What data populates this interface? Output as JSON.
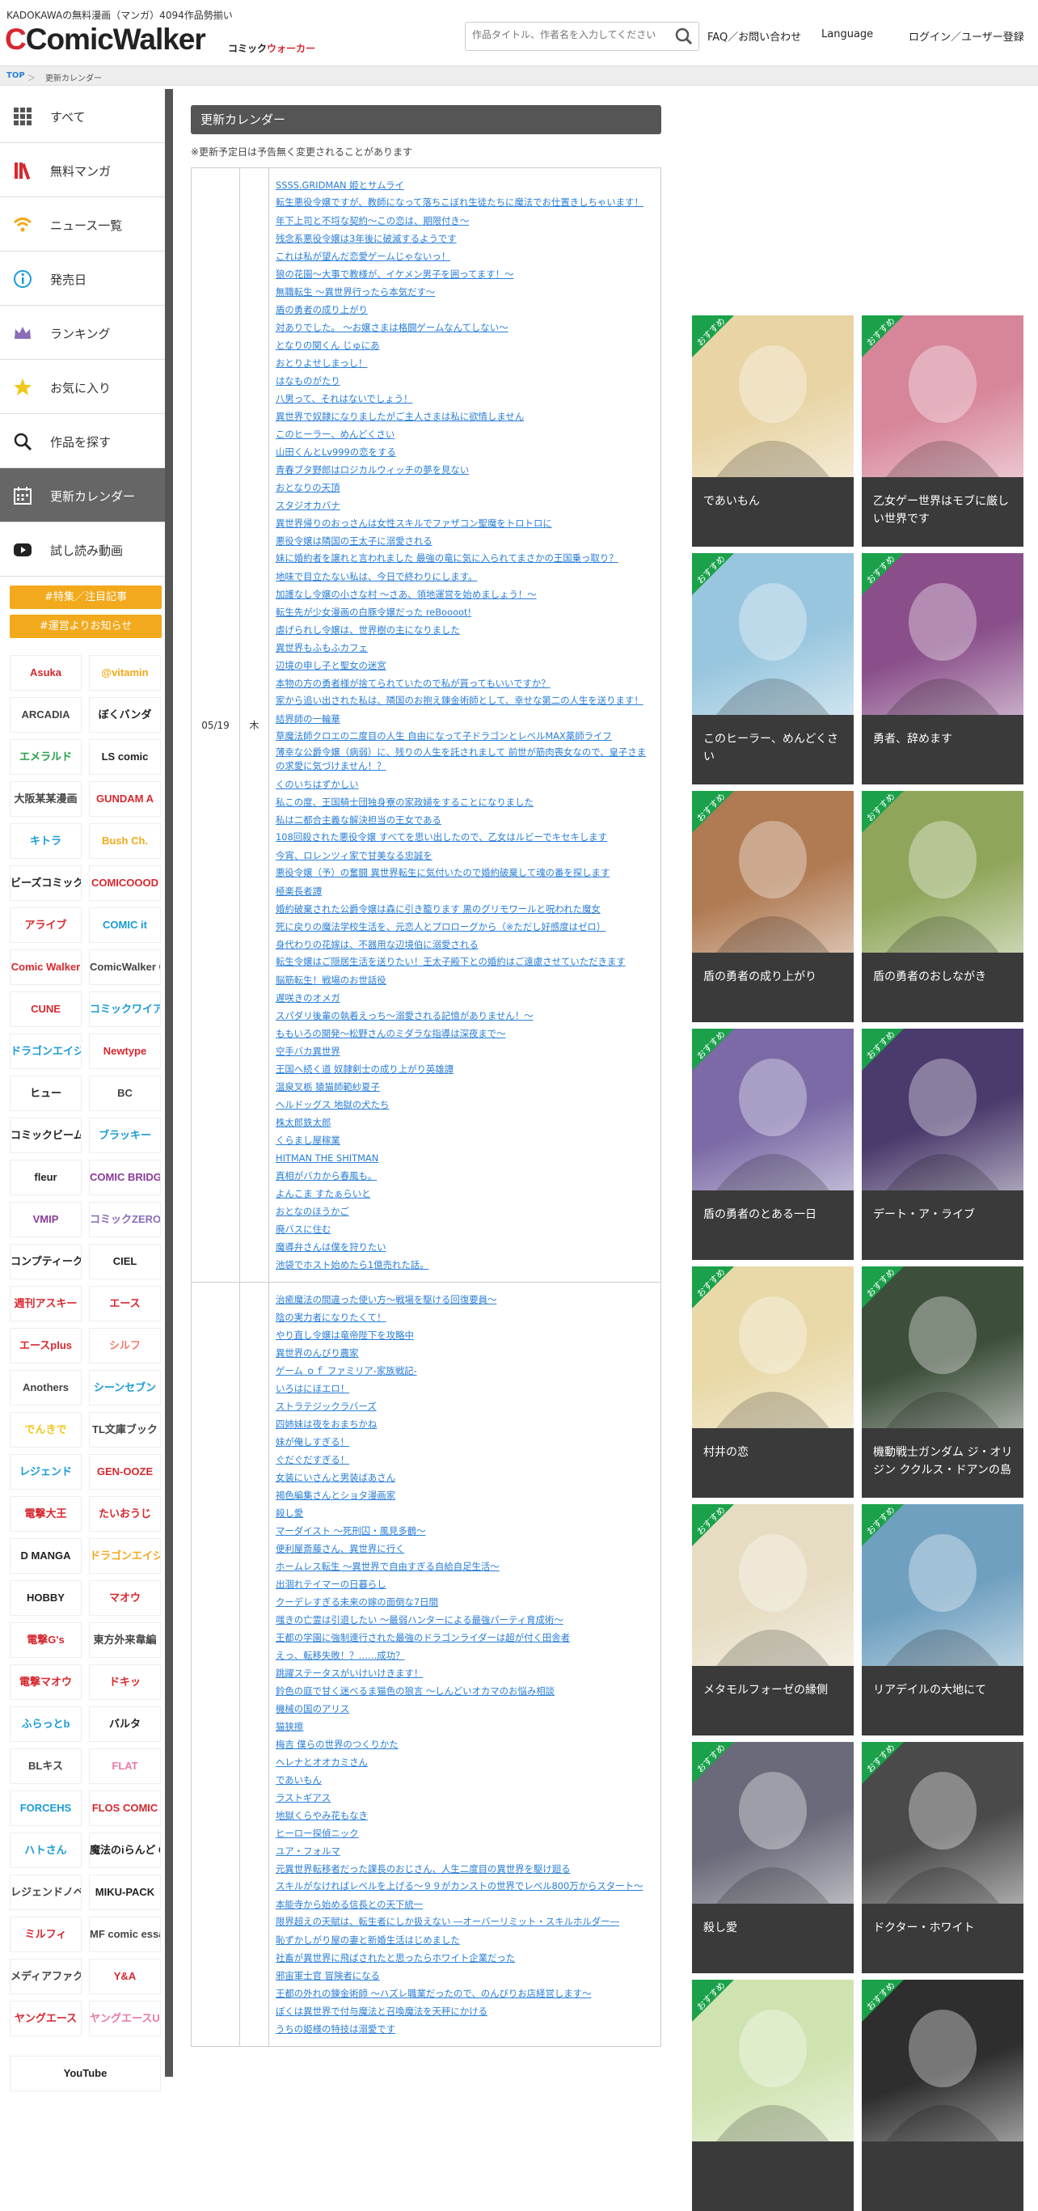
{
  "header": {
    "tagline": "KADOKAWAの無料漫画（マンガ）4094作品勢揃い",
    "logo_main": "ComicWalker",
    "logo_sub_1": "コミック",
    "logo_sub_2": "ウォーカー",
    "search_placeholder": "作品タイトル、作者名を入力してください",
    "nav": {
      "faq": "FAQ／お問い合わせ",
      "language": "Language",
      "login": "ログイン／ユーザー登録"
    }
  },
  "breadcrumb": {
    "top": "TOP",
    "sep": "＞",
    "current": "更新カレンダー"
  },
  "sidebar": {
    "items": [
      {
        "label": "すべて",
        "icon": "grid-icon"
      },
      {
        "label": "無料マンガ",
        "icon": "books-icon"
      },
      {
        "label": "ニュース一覧",
        "icon": "wifi-icon"
      },
      {
        "label": "発売日",
        "icon": "info-icon"
      },
      {
        "label": "ランキング",
        "icon": "crown-icon"
      },
      {
        "label": "お気に入り",
        "icon": "star-icon"
      },
      {
        "label": "作品を探す",
        "icon": "search-icon"
      },
      {
        "label": "更新カレンダー",
        "icon": "calendar-icon"
      },
      {
        "label": "試し読み動画",
        "icon": "youtube-icon"
      }
    ],
    "special_btn": "#特集／注目記事",
    "notice_btn": "#運営よりお知らせ",
    "labels": [
      "Asuka",
      "@vitamin",
      "ARCADIA",
      "ぼくバンダ",
      "エメラルド",
      "LS comic",
      "大阪某某漫画",
      "GUNDAM A",
      "キトラ",
      "Bush Ch.",
      "ビーズコミック",
      "COMICOOOD",
      "アライブ",
      "COMIC it",
      "Comic Walker",
      "ComicWalker GLOBAL",
      "CUNE",
      "コミックワイア",
      "ドラゴンエイジ",
      "Newtype",
      "ヒュー",
      "BC",
      "コミックビーム",
      "ブラッキー",
      "fleur",
      "COMIC BRIDGE",
      "VMIP",
      "コミックZERO",
      "コンプティーク",
      "CIEL",
      "週刊アスキー",
      "エース",
      "エースplus",
      "シルフ",
      "Anothers",
      "シーンセブン",
      "でんきで",
      "TL文庫ブック",
      "レジェンド",
      "GEN-OOZE",
      "電撃大王",
      "たいおうじ",
      "D MANGA",
      "ドラゴンエイジ",
      "HOBBY",
      "マオウ",
      "電撃G's",
      "東方外来韋編",
      "電撃マオウ",
      "ドキッ",
      "ふらっとb",
      "バルタ",
      "BLキス",
      "FLAT",
      "FORCEHS",
      "FLOS COMIC",
      "ハトさん",
      "魔法のiらんど COMICS",
      "レジェンドノベル",
      "MIKU-PACK",
      "ミルフィ",
      "MF comic essay",
      "メディアファクトリー",
      "Y&A",
      "ヤングエース",
      "ヤングエースUP"
    ],
    "youtube": "YouTube"
  },
  "calendar": {
    "heading": "更新カレンダー",
    "note": "※更新予定日は予告無く変更されることがあります",
    "rows": [
      {
        "date": "05/19",
        "weekday": "木",
        "links": [
          "SSSS.GRIDMAN 姫とサムライ",
          "転生悪役令嬢ですが、教師になって落ちこぼれ生徒たちに魔法でお仕置きしちゃいます！",
          "年下上司と不埒な契約～この恋は、期限付き～",
          "残念系悪役令嬢は3年後に破滅するようです",
          "これは私が望んだ恋愛ゲームじゃないっ！",
          "狼の花園～大事で教様が、イケメン男子を囲ってます！～",
          "無職転生 ～異世界行ったら本気だす～",
          "盾の勇者の成り上がり",
          "対ありでした。 ～お嬢さまは格闘ゲームなんてしない～",
          "となりの関くん じゅにあ",
          "おとりよせしまっし！",
          "はなものがたり",
          "八男って、それはないでしょう！",
          "異世界で奴隷になりましたがご主人さまは私に欲情しません",
          "このヒーラー、めんどくさい",
          "山田くんとLv999の恋をする",
          "青春ブタ野郎はロジカルウィッチの夢を見ない",
          "おとなりの天頂",
          "スタジオカバナ",
          "異世界帰りのおっさんは女性スキルでファザコン聖魔をトロトロに",
          "悪役令嬢は隣国の王太子に溺愛される",
          "妹に婚約者を譲れと言われました 最強の竜に気に入られてまさかの王国乗っ取り？",
          "地味で目立たない私は、今日で終わりにします。",
          "加護なし令嬢の小さな村 ～さあ、領地運営を始めましょう！～",
          "転生先が少女漫画の白豚令嬢だった reBoooot!",
          "虐げられし令嬢は、世界樹の主になりました",
          "異世界もふもふカフェ",
          "辺境の申し子と聖女の迷宮",
          "本物の方の勇者様が捨てられていたので私が貰ってもいいですか？",
          "家から追い出された私は、隣国のお抱え錬金術師として、幸せな第二の人生を送ります！",
          "結界師の一輪華",
          "草魔法師クロエの二度目の人生 自由になって子ドラゴンとレベルMAX薬師ライフ",
          "薄幸な公爵令嬢（病弱）に、残りの人生を託されまして 前世が筋肉喪女なので、皇子さまの求愛に気づけません！？",
          "くのいちはずかしい",
          "私この度、王国騎士団独身寮の家政婦をすることになりました",
          "私は二都合主義な解決担当の王女である",
          "108回殺された悪役令嬢 すべてを思い出したので、乙女はルビーでキセキします",
          "今宵、ロレンツィ家で甘美なる忠誠を",
          "悪役令嬢（予）の奮闘 異世界転生に気付いたので婚約破棄して魂の番を探します",
          "極楽長者譚",
          "婚約破棄された公爵令嬢は森に引き籠ります 黒のグリモワールと呪われた魔女",
          "死に戻りの魔法学校生活を、元恋人とプロローグから（※ただし好感度はゼロ）",
          "身代わりの花嫁は、不器用な辺境伯に溺愛される",
          "転生令嬢はご隠居生活を送りたい！王太子殿下との婚約はご遠慮させていただきます",
          "脳筋転生！戦場のお世話役",
          "遅咲きのオメガ",
          "スパダリ後輩の執着えっち～溺愛される記憶がありません！～",
          "ももいろの開発～松野さんのミダラな指導は深夜まで～",
          "空手バカ異世界",
          "王国へ続く道 奴隷剣士の成り上がり英雄譚",
          "温泉叉栃 猿猫師範紗夏子",
          "ヘルドッグス 地獄の犬たち",
          "株太郎鉄太郎",
          "くらまし屋稼業",
          "HITMAN THE SHITMAN",
          "真相がバカから春風も。",
          "よんこま すたぁらいと",
          "おとなのほうかご",
          "廃バスに住む",
          "魔導弁さんは僕を狩りたい",
          "池袋でホスト始めたら1億売れた話。"
        ]
      },
      {
        "date": "",
        "weekday": "",
        "links": [
          "治癒魔法の間違った使い方～戦場を駆ける回復要員～",
          "陰の実力者になりたくて！",
          "やり直し令嬢は竜帝陛下を攻略中",
          "異世界のんびり農家",
          "ゲーム ｏｆ ファミリア-家族戦記-",
          "いろはにほエロ！",
          "ストラテジックラバーズ",
          "四姉妹は夜をおまちかね",
          "妹が俺しすぎる！",
          "ぐだぐだすぎる！",
          "女装にいさんと男装ばあさん",
          "褐色編集さんとショタ漫画家",
          "殺し愛",
          "マーダイスト ～死刑囚・風見多鶴～",
          "便利屋斎藤さん、異世界に行く",
          "ホームレス転生 ～異世界で自由すぎる自給自足生活～",
          "出涸れテイマーの日暮らし",
          "クーデレすぎる未来の嫁の面倒な7日間",
          "嗤きの亡霊は引退したい ～最弱ハンターによる最強パーティ育成術～",
          "王都の学園に強制連行された最強のドラゴンライダーは超が付く田舎者",
          "えっ、転移失敗！？……成功？",
          "跳躍ステータスがいけいけきます！",
          "鈴色の庭で甘く迷べるま猫色の狼言 ～しんどいオカマのお悩み相談",
          "機械の国のアリス",
          "猫狭擦",
          "梅吉 僕らの世界のつくりかた",
          "ヘレナとオオカミさん",
          "であいもん",
          "ラストギアス",
          "地獄くらやみ花もなき",
          "ヒーロー探偵ニック",
          "ユア・フォルマ",
          "元異世界転移者だった課長のおじさん、人生二度目の異世界を駆け廻る",
          "スキルがなければレベルを上げる～９９がカンストの世界でレベル800万からスタート～",
          "本能寺から始める信長との天下統一",
          "限界超えの天賦は、転生者にしか扱えない ―オーバーリミット・スキルホルダー―",
          "恥ずかしがり屋の妻と新婚生活はじめました",
          "社畜が異世界に飛ばされたと思ったらホワイト企業だった",
          "邪宙軍士官 冒険者になる",
          "王都の外れの錬金術師 ～ハズレ職業だったので、のんびりお店経営します～",
          "ぼくは異世界で付与魔法と召喚魔法を天秤にかける",
          "うちの姫様の特技は溺愛です"
        ]
      }
    ]
  },
  "featured": [
    {
      "title": "であいもん",
      "badge": "おすすめ",
      "color": "#e8d4a4"
    },
    {
      "title": "乙女ゲー世界はモブに厳しい世界です",
      "badge": "おすすめ",
      "color": "#d7869a"
    },
    {
      "title": "このヒーラー、めんどくさい",
      "badge": "おすすめ",
      "color": "#98c6de"
    },
    {
      "title": "勇者、辞めます",
      "badge": "おすすめ",
      "color": "#8a4f8a"
    },
    {
      "title": "盾の勇者の成り上がり",
      "badge": "おすすめ",
      "color": "#b07a52"
    },
    {
      "title": "盾の勇者のおしながき",
      "badge": "おすすめ",
      "color": "#8fa65a"
    },
    {
      "title": "盾の勇者のとある一日",
      "badge": "おすすめ",
      "color": "#7b6aa6"
    },
    {
      "title": "デート・ア・ライブ",
      "badge": "おすすめ",
      "color": "#4b3a6c"
    },
    {
      "title": "村井の恋",
      "badge": "おすすめ",
      "color": "#e9d9a8"
    },
    {
      "title": "機動戦士ガンダム ジ・オリジン ククルス・ドアンの島",
      "badge": "おすすめ",
      "color": "#3d4f3a"
    },
    {
      "title": "メタモルフォーゼの縁側",
      "badge": "おすすめ",
      "color": "#e6dcc2"
    },
    {
      "title": "リアデイルの大地にて",
      "badge": "おすすめ",
      "color": "#6fa0c0"
    },
    {
      "title": "殺し愛",
      "badge": "おすすめ",
      "color": "#6a6a7a"
    },
    {
      "title": "ドクター・ホワイト",
      "badge": "おすすめ",
      "color": "#4a4a4a"
    },
    {
      "title": "",
      "badge": "おすすめ",
      "color": "#cfe3b0"
    },
    {
      "title": "",
      "badge": "おすすめ",
      "color": "#2e2e2e"
    }
  ]
}
